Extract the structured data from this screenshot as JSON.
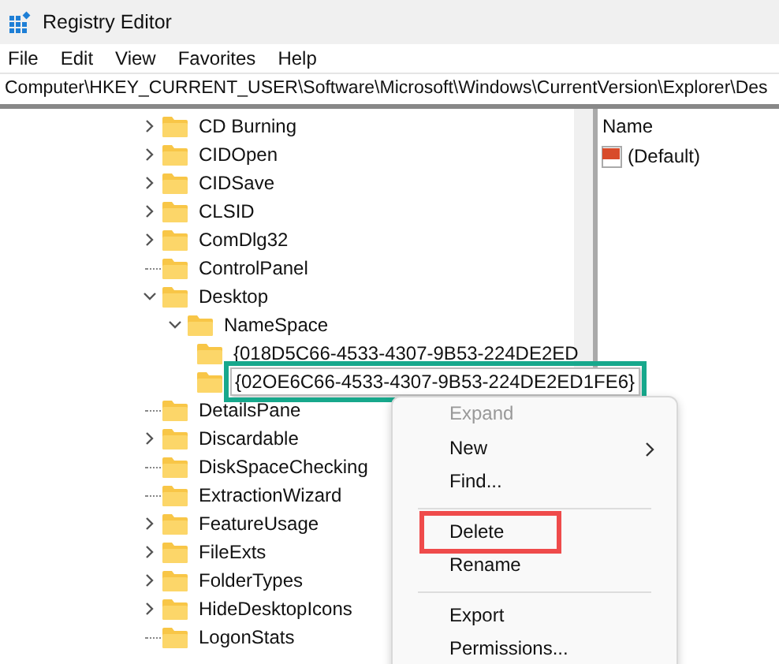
{
  "window": {
    "title": "Registry Editor"
  },
  "menu_bar": [
    "File",
    "Edit",
    "View",
    "Favorites",
    "Help"
  ],
  "address": "Computer\\HKEY_CURRENT_USER\\Software\\Microsoft\\Windows\\CurrentVersion\\Explorer\\Des",
  "tree": [
    {
      "label": "CD Burning",
      "expanded": false,
      "selected": false,
      "annotated": false
    },
    {
      "label": "CIDOpen",
      "expanded": false,
      "selected": false,
      "annotated": false
    },
    {
      "label": "CIDSave",
      "expanded": false,
      "selected": false,
      "annotated": false
    },
    {
      "label": "CLSID",
      "expanded": false,
      "selected": false,
      "annotated": false
    },
    {
      "label": "ComDlg32",
      "expanded": false,
      "selected": false,
      "annotated": false
    },
    {
      "label": "ControlPanel",
      "selected": false,
      "annotated": false
    },
    {
      "label": "Desktop",
      "expanded": true,
      "selected": false,
      "annotated": false,
      "children": [
        {
          "label": "NameSpace",
          "expanded": true,
          "selected": false,
          "annotated": false,
          "children": [
            {
              "label": "{018D5C66-4533-4307-9B53-224DE2ED",
              "selected": false,
              "annotated": false
            },
            {
              "label": "{02OE6C66-4533-4307-9B53-224DE2ED1FE6}",
              "selected": true,
              "annotated": true
            }
          ]
        }
      ]
    },
    {
      "label": "DetailsPane",
      "selected": false,
      "annotated": false
    },
    {
      "label": "Discardable",
      "expanded": false,
      "selected": false,
      "annotated": false
    },
    {
      "label": "DiskSpaceChecking",
      "selected": false,
      "annotated": false
    },
    {
      "label": "ExtractionWizard",
      "selected": false,
      "annotated": false
    },
    {
      "label": "FeatureUsage",
      "expanded": false,
      "selected": false,
      "annotated": false
    },
    {
      "label": "FileExts",
      "expanded": false,
      "selected": false,
      "annotated": false
    },
    {
      "label": "FolderTypes",
      "expanded": false,
      "selected": false,
      "annotated": false
    },
    {
      "label": "HideDesktopIcons",
      "expanded": false,
      "selected": false,
      "annotated": false
    },
    {
      "label": "LogonStats",
      "selected": false,
      "annotated": false
    }
  ],
  "values_pane": {
    "column_header": "Name",
    "rows": [
      {
        "name": "(Default)"
      }
    ]
  },
  "context_menu": [
    {
      "kind": "item",
      "label": "Expand",
      "disabled": true,
      "submenu": false,
      "annotated": false
    },
    {
      "kind": "item",
      "label": "New",
      "disabled": false,
      "submenu": true,
      "annotated": false
    },
    {
      "kind": "item",
      "label": "Find...",
      "disabled": false,
      "submenu": false,
      "annotated": false
    },
    {
      "kind": "separator"
    },
    {
      "kind": "item",
      "label": "Delete",
      "disabled": false,
      "submenu": false,
      "annotated": true
    },
    {
      "kind": "item",
      "label": "Rename",
      "disabled": false,
      "submenu": false,
      "annotated": false
    },
    {
      "kind": "separator"
    },
    {
      "kind": "item",
      "label": "Export",
      "disabled": false,
      "submenu": false,
      "annotated": false
    },
    {
      "kind": "item",
      "label": "Permissions...",
      "disabled": false,
      "submenu": false,
      "annotated": false
    }
  ]
}
